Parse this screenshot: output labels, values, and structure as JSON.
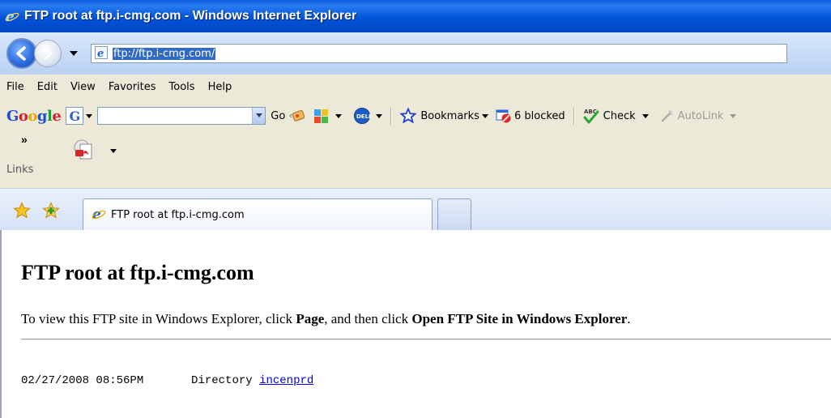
{
  "window": {
    "title": "FTP root at ftp.i-cmg.com - Windows Internet Explorer"
  },
  "address": {
    "url": "ftp://ftp.i-cmg.com/"
  },
  "menu": [
    "File",
    "Edit",
    "View",
    "Favorites",
    "Tools",
    "Help"
  ],
  "google_toolbar": {
    "logo_parts": [
      "G",
      "o",
      "o",
      "g",
      "l",
      "e"
    ],
    "box_letter": "G",
    "go_label": "Go",
    "bookmarks_label": "Bookmarks",
    "blocked_label": "6 blocked",
    "check_label": "Check",
    "autolink_label": "AutoLink"
  },
  "links_bar": {
    "chevron": "»",
    "label": "Links"
  },
  "tabs": [
    {
      "title": "FTP root at ftp.i-cmg.com",
      "active": true
    }
  ],
  "page": {
    "heading": "FTP root at ftp.i-cmg.com",
    "instruction_prefix": "To view this FTP site in Windows Explorer, click ",
    "instruction_page": "Page",
    "instruction_middle": ", and then click ",
    "instruction_open": "Open FTP Site in Windows Explorer",
    "instruction_suffix": ".",
    "listing": [
      {
        "datetime": "02/27/2008 08:56PM",
        "type": "Directory",
        "name": "incenprd"
      }
    ]
  },
  "colors": {
    "titlebar": "#0053d9",
    "link": "#0000ee",
    "chrome": "#ece9d8"
  }
}
